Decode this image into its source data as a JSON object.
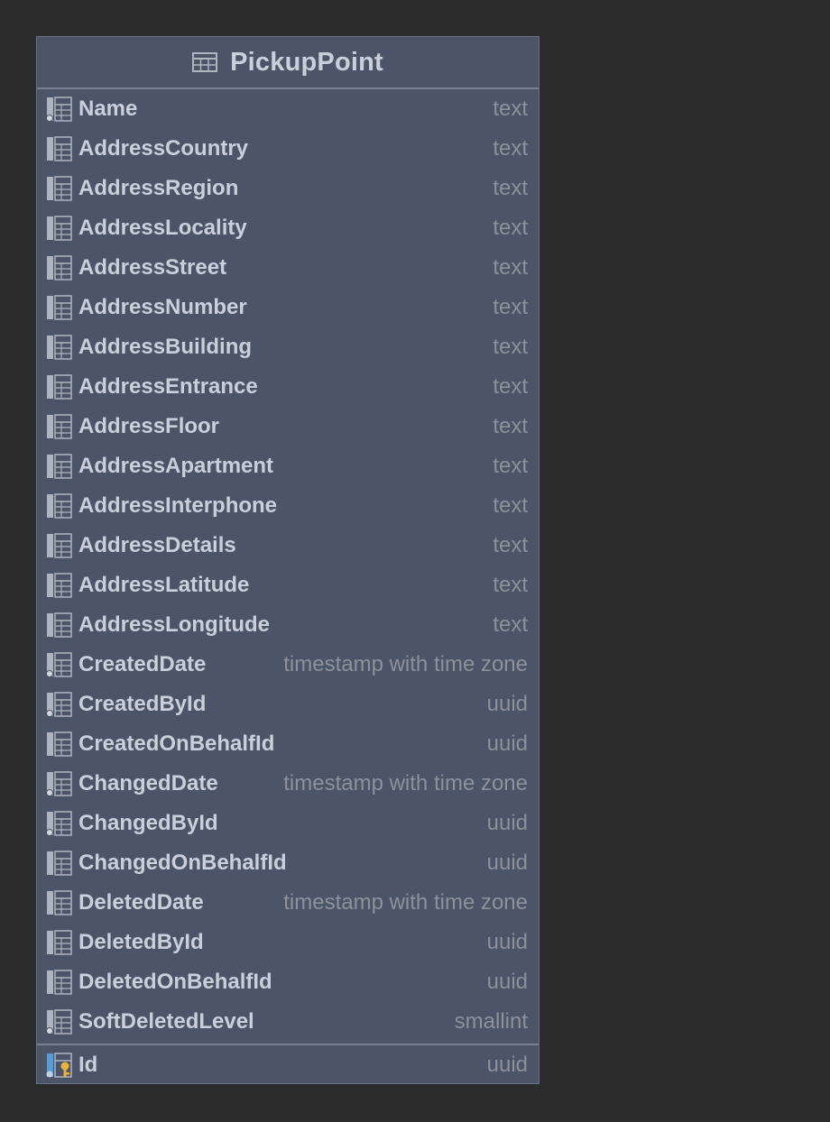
{
  "entity": {
    "name": "PickupPoint",
    "icon": "table-icon"
  },
  "columns": [
    {
      "name": "Name",
      "type": "text",
      "nullable_marker": true
    },
    {
      "name": "AddressCountry",
      "type": "text",
      "nullable_marker": false
    },
    {
      "name": "AddressRegion",
      "type": "text",
      "nullable_marker": false
    },
    {
      "name": "AddressLocality",
      "type": "text",
      "nullable_marker": false
    },
    {
      "name": "AddressStreet",
      "type": "text",
      "nullable_marker": false
    },
    {
      "name": "AddressNumber",
      "type": "text",
      "nullable_marker": false
    },
    {
      "name": "AddressBuilding",
      "type": "text",
      "nullable_marker": false
    },
    {
      "name": "AddressEntrance",
      "type": "text",
      "nullable_marker": false
    },
    {
      "name": "AddressFloor",
      "type": "text",
      "nullable_marker": false
    },
    {
      "name": "AddressApartment",
      "type": "text",
      "nullable_marker": false
    },
    {
      "name": "AddressInterphone",
      "type": "text",
      "nullable_marker": false
    },
    {
      "name": "AddressDetails",
      "type": "text",
      "nullable_marker": false
    },
    {
      "name": "AddressLatitude",
      "type": "text",
      "nullable_marker": false
    },
    {
      "name": "AddressLongitude",
      "type": "text",
      "nullable_marker": false
    },
    {
      "name": "CreatedDate",
      "type": "timestamp with time zone",
      "nullable_marker": true
    },
    {
      "name": "CreatedById",
      "type": "uuid",
      "nullable_marker": true
    },
    {
      "name": "CreatedOnBehalfId",
      "type": "uuid",
      "nullable_marker": false
    },
    {
      "name": "ChangedDate",
      "type": "timestamp with time zone",
      "nullable_marker": true
    },
    {
      "name": "ChangedById",
      "type": "uuid",
      "nullable_marker": true
    },
    {
      "name": "ChangedOnBehalfId",
      "type": "uuid",
      "nullable_marker": false
    },
    {
      "name": "DeletedDate",
      "type": "timestamp with time zone",
      "nullable_marker": false
    },
    {
      "name": "DeletedById",
      "type": "uuid",
      "nullable_marker": false
    },
    {
      "name": "DeletedOnBehalfId",
      "type": "uuid",
      "nullable_marker": false
    },
    {
      "name": "SoftDeletedLevel",
      "type": "smallint",
      "nullable_marker": true
    }
  ],
  "primary_key": {
    "name": "Id",
    "type": "uuid",
    "icon": "primary-key-icon"
  },
  "colors": {
    "background": "#2b2b2b",
    "entity_fill": "#4c5467",
    "text": "#c9cfdb",
    "type_text": "#8c919b",
    "key_accent": "#e8b43c",
    "pk_column_accent": "#5b9bd5"
  }
}
